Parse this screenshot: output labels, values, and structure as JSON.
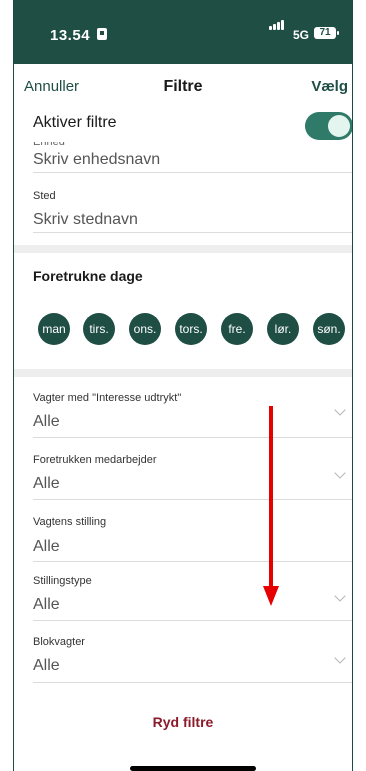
{
  "status": {
    "time": "13.54",
    "network": "5G",
    "battery": "71"
  },
  "nav": {
    "cancel": "Annuller",
    "title": "Filtre",
    "choose": "Vælg"
  },
  "activate": {
    "label": "Aktiver filtre",
    "enabled": true
  },
  "ghost_label": "Enhed",
  "unit": {
    "placeholder": "Skriv enhedsnavn"
  },
  "place": {
    "label": "Sted",
    "placeholder": "Skriv stednavn"
  },
  "days": {
    "title": "Foretrukne dage",
    "items": [
      "man",
      "tirs.",
      "ons.",
      "tors.",
      "fre.",
      "lør.",
      "søn."
    ]
  },
  "filters": [
    {
      "label": "Vagter med \"Interesse udtrykt\"",
      "value": "Alle"
    },
    {
      "label": "Foretrukken medarbejder",
      "value": "Alle"
    },
    {
      "label": "Vagtens stilling",
      "value": "Alle"
    },
    {
      "label": "Stillingstype",
      "value": "Alle"
    },
    {
      "label": "Blokvagter",
      "value": "Alle"
    }
  ],
  "clear_label": "Ryd filtre",
  "colors": {
    "header": "#1f4e45",
    "accent": "#2f7a68",
    "danger": "#8b1a2b",
    "annotation": "#e60000"
  }
}
